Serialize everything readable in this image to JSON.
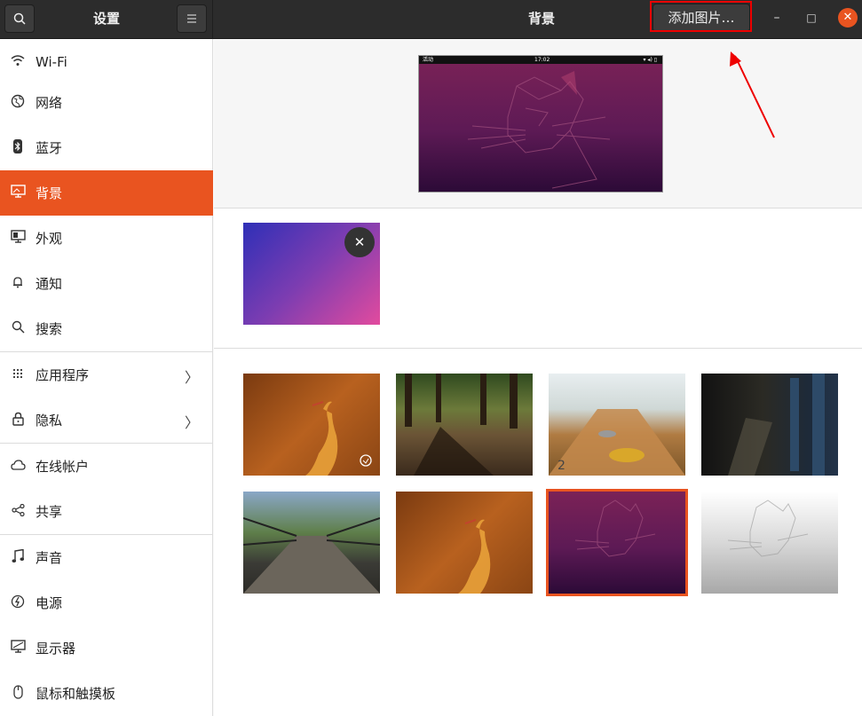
{
  "titlebar": {
    "sidebar_title": "设置",
    "page_title": "背景",
    "add_button": "添加图片…",
    "minimize": "–",
    "maximize": "□",
    "close": "✕"
  },
  "sidebar": {
    "items": [
      {
        "label": "Wi-Fi",
        "icon": "wifi-icon"
      },
      {
        "label": "网络",
        "icon": "network-icon"
      },
      {
        "label": "蓝牙",
        "icon": "bluetooth-icon"
      },
      {
        "label": "背景",
        "icon": "background-icon"
      },
      {
        "label": "外观",
        "icon": "appearance-icon"
      },
      {
        "label": "通知",
        "icon": "bell-icon"
      },
      {
        "label": "搜索",
        "icon": "search-icon"
      },
      {
        "label": "应用程序",
        "icon": "apps-icon"
      },
      {
        "label": "隐私",
        "icon": "lock-icon"
      },
      {
        "label": "在线帐户",
        "icon": "cloud-icon"
      },
      {
        "label": "共享",
        "icon": "share-icon"
      },
      {
        "label": "声音",
        "icon": "music-icon"
      },
      {
        "label": "电源",
        "icon": "power-icon"
      },
      {
        "label": "显示器",
        "icon": "display-icon"
      },
      {
        "label": "鼠标和触摸板",
        "icon": "mouse-icon"
      }
    ],
    "active_index": 3
  },
  "preview": {
    "topbar_left": "活动",
    "topbar_time": "17:02"
  },
  "colors": {
    "accent": "#e95420",
    "titlebar": "#2c2c2c",
    "highlight": "#ee0000"
  }
}
